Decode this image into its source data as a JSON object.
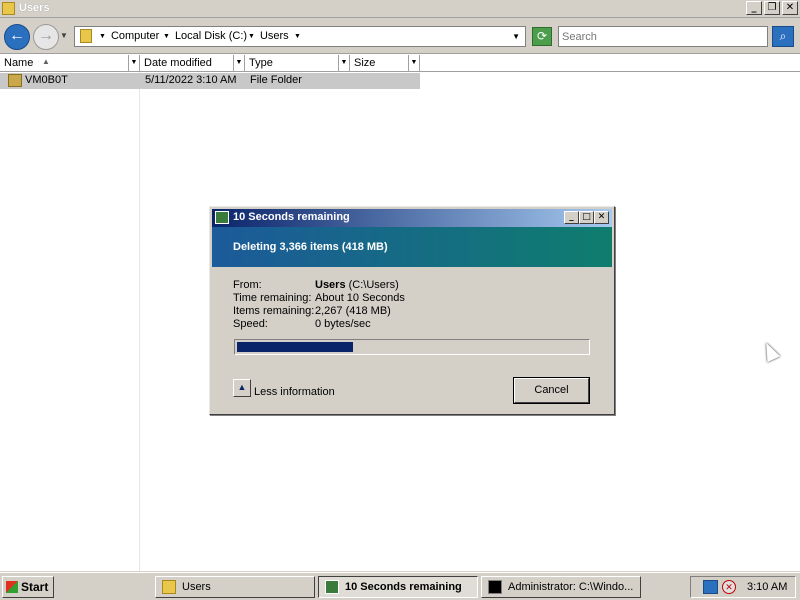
{
  "explorer": {
    "title": "Users",
    "window_buttons": {
      "minimize": "_",
      "maximize": "❐",
      "close": "✕"
    },
    "address": {
      "crumbs": [
        "Computer",
        "Local Disk (C:)",
        "Users"
      ]
    },
    "search": {
      "placeholder": "Search"
    },
    "columns": [
      "Name",
      "Date modified",
      "Type",
      "Size"
    ],
    "files": [
      {
        "name": "VM0B0T",
        "date": "5/11/2022 3:10 AM",
        "type": "File Folder",
        "size": ""
      }
    ]
  },
  "dialog": {
    "title": "10 Seconds remaining",
    "header": "Deleting 3,366 items (418 MB)",
    "fields": [
      {
        "label": "From:",
        "value_bold": "Users",
        "value": " (C:\\Users)"
      },
      {
        "label": "Time remaining:",
        "value": "About 10 Seconds"
      },
      {
        "label": "Items remaining:",
        "value": "2,267 (418 MB)"
      },
      {
        "label": "Speed:",
        "value": "0 bytes/sec"
      }
    ],
    "progress_fraction": 0.33,
    "less_info_label": "Less information",
    "cancel_label": "Cancel"
  },
  "taskbar": {
    "start_label": "Start",
    "tasks": [
      {
        "label": "Users",
        "active": false
      },
      {
        "label": "10 Seconds remaining",
        "active": true
      },
      {
        "label": "Administrator: C:\\Windo...",
        "active": false
      }
    ],
    "clock": "3:10 AM"
  },
  "colors": {
    "dialog_title_start": "#0a246a",
    "dialog_header_start": "#1c5a9a",
    "dialog_header_end": "#0f7d6e",
    "progress_fill": "#0a246a"
  }
}
